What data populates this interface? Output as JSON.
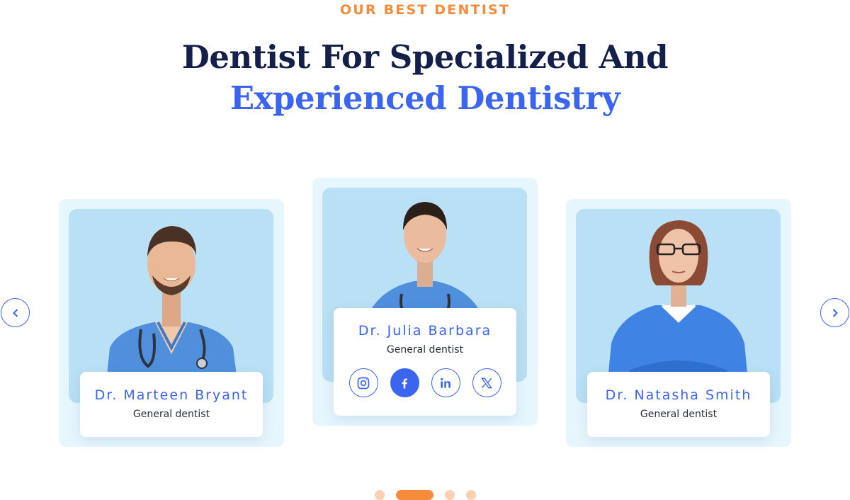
{
  "section": {
    "eyebrow": "OUR BEST DENTIST",
    "title_line1": "Dentist For Specialized And",
    "title_line2": "Experienced Dentistry"
  },
  "colors": {
    "accent_orange": "#f68b3a",
    "navy": "#14204a",
    "brand_blue": "#3b64ef",
    "card_bg": "#e6f6fd",
    "photo_bg": "#b9e0f4"
  },
  "dentists": [
    {
      "name": "Dr. Marteen Bryant",
      "role": "General dentist"
    },
    {
      "name": "Dr. Julia Barbara",
      "role": "General dentist"
    },
    {
      "name": "Dr. Natasha Smith",
      "role": "General dentist"
    }
  ],
  "socials": [
    {
      "icon": "instagram-icon"
    },
    {
      "icon": "facebook-icon"
    },
    {
      "icon": "linkedin-icon"
    },
    {
      "icon": "x-twitter-icon"
    }
  ],
  "carousel": {
    "prev_icon": "chevron-left-icon",
    "next_icon": "chevron-right-icon",
    "active_page": 2,
    "page_count": 4
  }
}
